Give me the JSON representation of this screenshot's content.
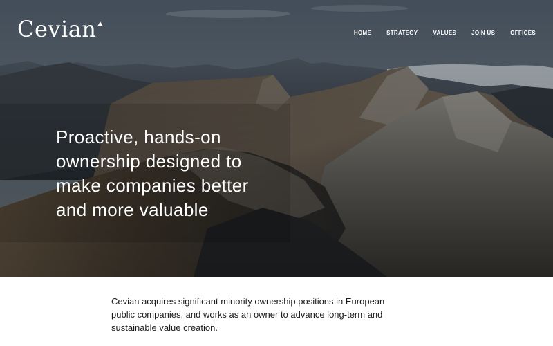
{
  "header": {
    "logo_text": "Cevian",
    "nav": [
      {
        "label": "HOME"
      },
      {
        "label": "STRATEGY"
      },
      {
        "label": "VALUES"
      },
      {
        "label": "JOIN US"
      },
      {
        "label": "OFFICES"
      }
    ]
  },
  "hero": {
    "headline": "Proactive, hands-on ownership designed to make companies better and more valuable"
  },
  "intro": {
    "text": "Cevian acquires significant minority ownership positions in European public companies, and works as an owner to advance long-term and sustainable value creation."
  }
}
